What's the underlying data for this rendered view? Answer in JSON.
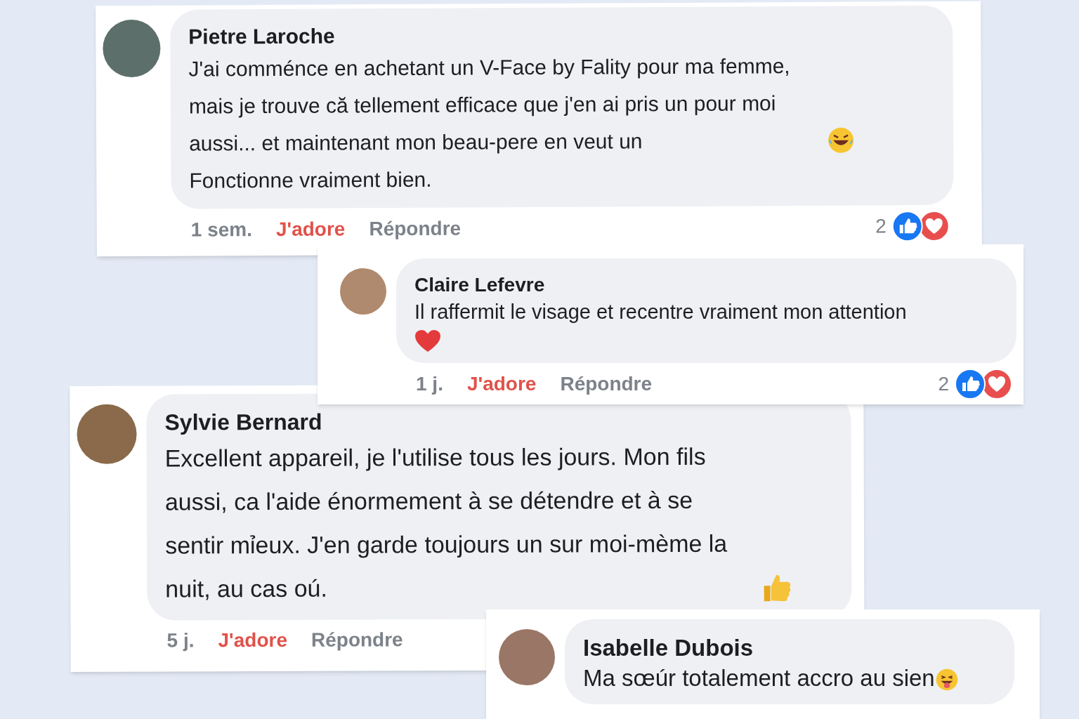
{
  "comments": [
    {
      "kind": "laugh",
      "author": "Pietre Laroche",
      "text": "J'ai comménce en achetant  un V-Face by Fality pour ma femme, mais je trouve că tellement efficace que j'en ai pris un pour moi aussi... et maintenant mon beau-pere en veut un",
      "text_after": "Fonctionne vraiment bien.",
      "time": "1 sem.",
      "like": "J'adore",
      "liked": true,
      "reply": "Répondre",
      "reaction_count": "2"
    },
    {
      "kind": "heart",
      "author": "Claire Lefevre",
      "text": "Il raffermit le visage et recentre vraiment mon attention",
      "time": "1 j.",
      "like": "J'adore",
      "liked": true,
      "reply": "Répondre",
      "reaction_count": "2"
    },
    {
      "kind": "thumbs",
      "author": "Sylvie Bernard",
      "text": "Excellent appareil, je l'utilise tous les jours. Mon fils aussi, ca l'aide énormement à se détendre et à se sentir mỉeux. J'en garde toujours un sur moi-mème la nuit, au cas oú.",
      "time": "5 j.",
      "like": "J'adore",
      "liked": true,
      "reply": "Répondre"
    },
    {
      "kind": "tongue",
      "author": "Isabelle Dubois",
      "text": "Ma sœúr totalement accro au sien"
    }
  ]
}
